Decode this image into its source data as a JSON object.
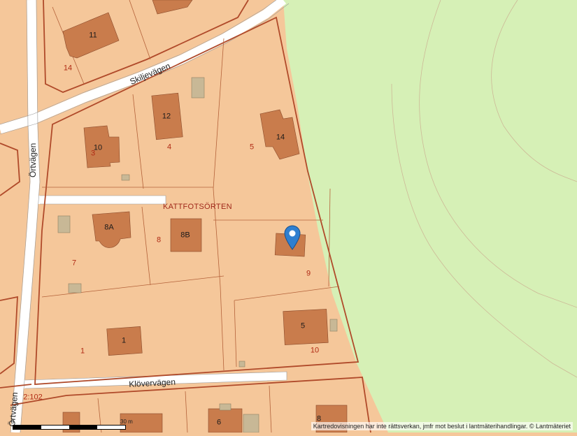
{
  "map": {
    "streets": {
      "skiljevagen": "Skiljevägen",
      "ortvagen_top": "Örtvägen",
      "ortvagen_bottom": "Örtvägen",
      "klovervagen": "Klövervägen"
    },
    "district": "KATTFOTSÖRTEN",
    "house_numbers": [
      "11",
      "12",
      "10",
      "14",
      "8A",
      "8B",
      "3",
      "5",
      "1",
      "6",
      "8"
    ],
    "parcel_numbers": [
      "14",
      "3",
      "4",
      "5",
      "8",
      "7",
      "9",
      "1",
      "10"
    ],
    "parcel_code": "2:102",
    "scale": {
      "zero": "0",
      "label": "30 m"
    },
    "attribution": "Kartredovisningen har inte rättsverkan, jmfr mot beslut i lantmäterihandlingar. © Lantmäteriet",
    "colors": {
      "built_area": "#f5c79a",
      "forest": "#d6f0b6",
      "building": "#c97c4c",
      "outbuilding": "#c8b896",
      "road": "#ffffff",
      "boundary": "#b04a2a",
      "pin": "#2f7fd0"
    },
    "icons": {
      "marker": "map-pin-icon"
    }
  }
}
